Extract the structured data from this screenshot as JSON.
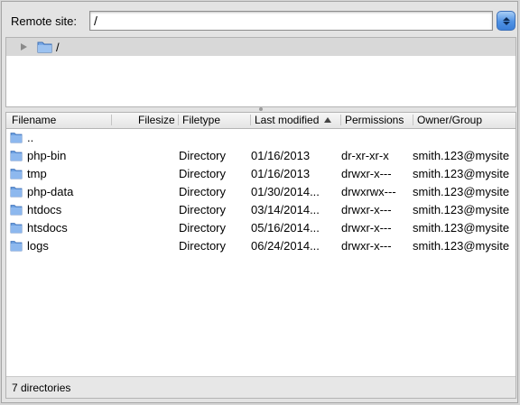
{
  "remote": {
    "label": "Remote site:",
    "path": "/"
  },
  "tree": {
    "root_label": "/"
  },
  "columns": [
    {
      "label": "Filename"
    },
    {
      "label": "Filesize"
    },
    {
      "label": "Filetype"
    },
    {
      "label": "Last modified"
    },
    {
      "label": "Permissions"
    },
    {
      "label": "Owner/Group"
    }
  ],
  "files": [
    {
      "name": "..",
      "type": "",
      "modified": "",
      "perms": "",
      "owner": ""
    },
    {
      "name": "php-bin",
      "type": "Directory",
      "modified": "01/16/2013",
      "perms": "dr-xr-xr-x",
      "owner": "smith.123@mysite"
    },
    {
      "name": "tmp",
      "type": "Directory",
      "modified": "01/16/2013",
      "perms": "drwxr-x---",
      "owner": "smith.123@mysite"
    },
    {
      "name": "php-data",
      "type": "Directory",
      "modified": "01/30/2014...",
      "perms": "drwxrwx---",
      "owner": "smith.123@mysite"
    },
    {
      "name": "htdocs",
      "type": "Directory",
      "modified": "03/14/2014...",
      "perms": "drwxr-x---",
      "owner": "smith.123@mysite"
    },
    {
      "name": "htsdocs",
      "type": "Directory",
      "modified": "05/16/2014...",
      "perms": "drwxr-x---",
      "owner": "smith.123@mysite"
    },
    {
      "name": "logs",
      "type": "Directory",
      "modified": "06/24/2014...",
      "perms": "drwxr-x---",
      "owner": "smith.123@mysite"
    }
  ],
  "status": {
    "text": "7 directories"
  },
  "colors": {
    "folder": "#6b9fe0",
    "selection_row": "#d8d8d8",
    "dropdown_accent": "#4f92e4"
  },
  "icons": {
    "folder": "folder-icon",
    "expand": "disclosure-triangle-icon",
    "sort": "sort-ascending-icon",
    "dropdown": "dropdown-stepper-icon"
  }
}
